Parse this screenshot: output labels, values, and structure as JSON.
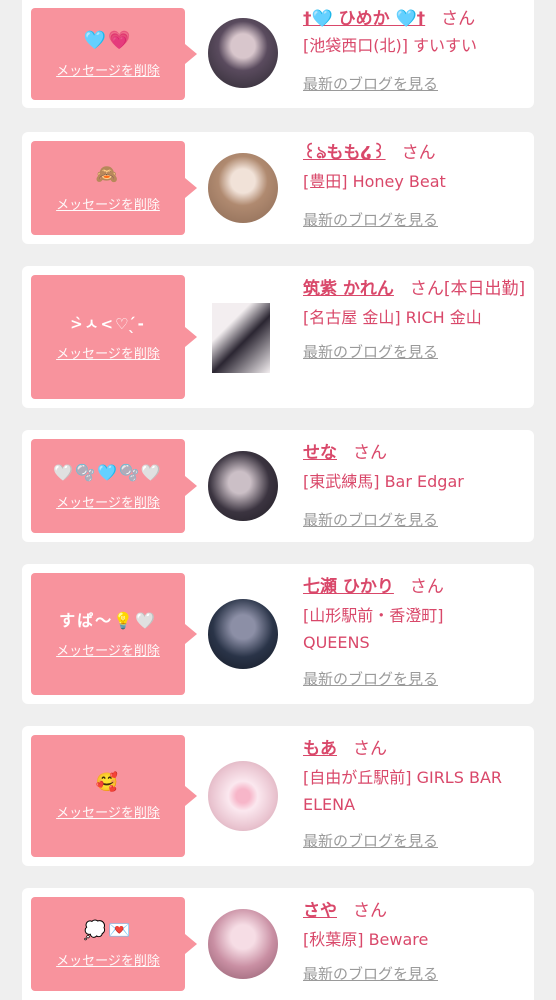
{
  "entries": [
    {
      "message": "🩵💗",
      "delete_label": "メッセージを削除",
      "name": "†🩵 ひめか 🩵†",
      "honorific": "さん",
      "shop": "[池袋西口(北)] すいすい",
      "blog_label": "最新のブログを見る",
      "avatar_colors": [
        "#5a4b5e",
        "#d8c6cc"
      ]
    },
    {
      "message": "🙈",
      "delete_label": "メッセージを削除",
      "name": "꒰ঌもも໒꒱",
      "honorific": "さん",
      "shop": "[豊田] Honey Beat",
      "blog_label": "最新のブログを見る",
      "avatar_colors": [
        "#8b6a55",
        "#f1e2d8"
      ]
    },
    {
      "message": ">̀ㅅ<♡ ̖́-",
      "delete_label": "メッセージを削除",
      "name": "筑紫 かれん",
      "honorific": "さん[本日出勤]",
      "shop": "[名古屋 金山] RICH 金山",
      "blog_label": "最新のブログを見る",
      "avatar_colors": [
        "#2b2632",
        "#f3eef0"
      ]
    },
    {
      "message": "🤍🫧🩵🫧🤍",
      "delete_label": "メッセージを削除",
      "name": "せな",
      "honorific": "さん",
      "shop": "[東武練馬] Bar Edgar",
      "blog_label": "最新のブログを見る",
      "avatar_colors": [
        "#3b3440",
        "#cbbfc6"
      ]
    },
    {
      "message": "すぱ〜💡🤍",
      "delete_label": "メッセージを削除",
      "name": "七瀬 ひかり",
      "honorific": "さん",
      "shop": "[山形駅前・香澄町] QUEENS",
      "blog_label": "最新のブログを見る",
      "avatar_colors": [
        "#2a3448",
        "#8c8fa6"
      ]
    },
    {
      "message": "🥰",
      "delete_label": "メッセージを削除",
      "name": "もあ",
      "honorific": "さん",
      "shop": "[自由が丘駅前] GIRLS BAR ELENA",
      "blog_label": "最新のブログを見る",
      "avatar_colors": [
        "#e9c3cf",
        "#fbe8ef"
      ]
    },
    {
      "message": "💭💌",
      "delete_label": "メッセージを削除",
      "name": "さや",
      "honorific": "さん",
      "shop": "[秋葉原] Beware",
      "blog_label": "最新のブログを見る",
      "avatar_colors": [
        "#c98fa3",
        "#f6dde5"
      ]
    }
  ]
}
